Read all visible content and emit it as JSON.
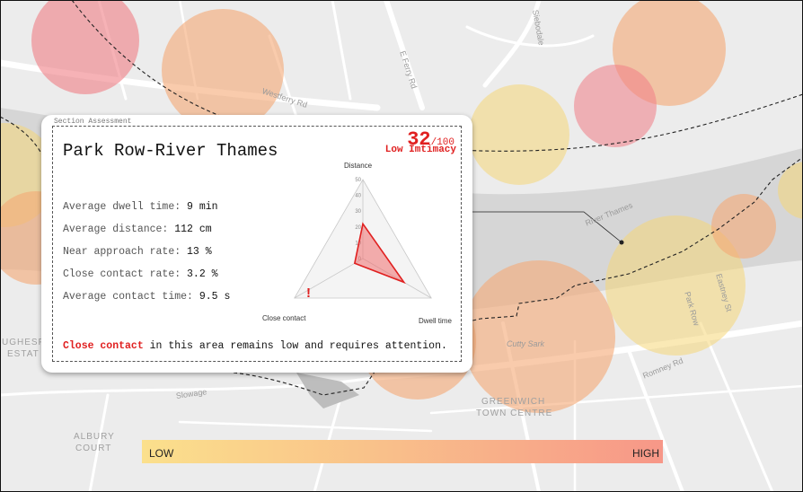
{
  "map": {
    "streets": {
      "westferry": "Westferry Rd",
      "e_ferry": "E Ferry Rd",
      "river": "River Thames",
      "slowage": "Slowage",
      "romney": "Romney Rd",
      "eastney": "Eastney St",
      "park_row": "Park Row",
      "cutty_sark": "Cutty Sark",
      "siebodale": "Siebodale"
    },
    "areas": {
      "greenwich_1": "GREENWICH",
      "greenwich_2": "TOWN CENTRE",
      "hughesf_1": "UGHESF",
      "hughesf_2": "ESTAT",
      "albury_1": "ALBURY",
      "albury_2": "COURT"
    },
    "circle_colors": {
      "low": "#f6d778",
      "mid": "#f5a874",
      "high": "#f07e86"
    }
  },
  "card": {
    "section_label": "Section Assessment",
    "title": "Park Row-River Thames",
    "score": {
      "value": "32",
      "max": "/100",
      "label": "Low Imtimacy"
    },
    "metrics": [
      {
        "label": "Average dwell time:",
        "value": "9 min"
      },
      {
        "label": "Average distance:",
        "value": "112 cm"
      },
      {
        "label": "Near approach rate:",
        "value": "13 %"
      },
      {
        "label": "Close contact rate:",
        "value": "3.2 %"
      },
      {
        "label": "Average contact time:",
        "value": "9.5 s"
      }
    ],
    "note": {
      "highlight": "Close contact",
      "rest": " in this area remains low and requires attention."
    },
    "warning_glyph": "!"
  },
  "chart_data": {
    "type": "radar",
    "axes": [
      "Distance",
      "Dwell time",
      "Close contact"
    ],
    "ticks": [
      "0",
      "10",
      "20",
      "30",
      "40",
      "50"
    ],
    "range": [
      0,
      50
    ],
    "values": [
      22,
      30,
      6
    ],
    "colors": {
      "fill": "#f07070",
      "stroke": "#e02020"
    }
  },
  "legend": {
    "low": "LOW",
    "high": "HIGH"
  }
}
